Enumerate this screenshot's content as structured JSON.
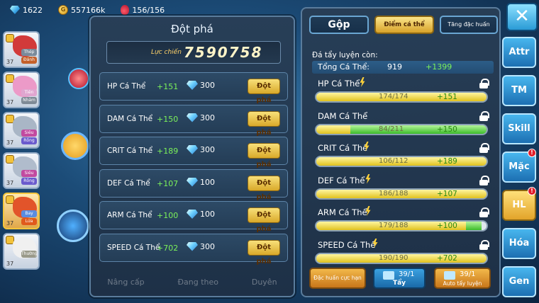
{
  "resources": {
    "gems": "1622",
    "coins": "557166k",
    "stamina": "156/156"
  },
  "team": [
    {
      "lv": "37",
      "type1": "Thép",
      "type2": "Đánh",
      "color": "#d23a3a",
      "tag1": "#7a8a9a",
      "tag2": "#c4602a"
    },
    {
      "lv": "37",
      "type1": "Tiên",
      "type2": "Nhảm",
      "color": "#ec9ac8",
      "tag1": "#e0a6d0",
      "tag2": "#7e8a96"
    },
    {
      "lv": "37",
      "type1": "Siêu",
      "type2": "Rồng",
      "color": "#a9b6c6",
      "tag1": "#c24aa0",
      "tag2": "#6a5acd"
    },
    {
      "lv": "37",
      "type1": "Siêu",
      "type2": "Rồng",
      "color": "#b0bccc",
      "tag1": "#c24aa0",
      "tag2": "#6a5acd"
    },
    {
      "lv": "37",
      "type1": "Bay",
      "type2": "Lửa",
      "color": "#e2542a",
      "tag1": "#5b8ce0",
      "tag2": "#e05a1c"
    },
    {
      "lv": "37",
      "type1": "Thường",
      "type2": "",
      "color": "#f0f0f0",
      "tag1": "#9a9a8a",
      "tag2": ""
    }
  ],
  "breakthrough": {
    "title": "Đột phá",
    "power_label": "Lực chiến",
    "power_value": "7590758",
    "rows": [
      {
        "name": "HP Cá Thể",
        "bonus": "+151",
        "cost": "300",
        "button": "Đột phá"
      },
      {
        "name": "DAM Cá Thể",
        "bonus": "+150",
        "cost": "300",
        "button": "Đột phá"
      },
      {
        "name": "CRIT Cá Thể",
        "bonus": "+189",
        "cost": "300",
        "button": "Đột phá"
      },
      {
        "name": "DEF Cá Thể",
        "bonus": "+107",
        "cost": "100",
        "button": "Đột phá"
      },
      {
        "name": "ARM Cá Thể",
        "bonus": "+100",
        "cost": "100",
        "button": "Đột phá"
      },
      {
        "name": "SPEED Cá Thể",
        "bonus": "+702",
        "cost": "300",
        "button": "Đột phá"
      }
    ],
    "bottom_nav": [
      "Nâng cấp",
      "Đang theo",
      "Duyên"
    ]
  },
  "individual": {
    "tabs": [
      "Gộp",
      "Điểm cá thể",
      "Tăng đặc huấn"
    ],
    "hint": "Đá tẩy luyện còn:",
    "total_label": "Tổng Cá Thể:",
    "total_value": "919",
    "total_bonus": "+1399",
    "stats": [
      {
        "name": "HP Cá Thể",
        "current": "174/174",
        "bonus": "+151",
        "fill": 1.0,
        "bonus_start": 1.0,
        "bonus_end": 1.0
      },
      {
        "name": "DAM Cá Thể",
        "current": "84/211",
        "bonus": "+150",
        "fill": 0.2,
        "bonus_start": 0.2,
        "bonus_end": 1.0
      },
      {
        "name": "CRIT Cá Thể",
        "current": "106/112",
        "bonus": "+189",
        "fill": 1.0,
        "bonus_start": 1.0,
        "bonus_end": 1.0
      },
      {
        "name": "DEF Cá Thể",
        "current": "186/188",
        "bonus": "+107",
        "fill": 1.0,
        "bonus_start": 1.0,
        "bonus_end": 1.0
      },
      {
        "name": "ARM Cá Thể",
        "current": "179/188",
        "bonus": "+100",
        "fill": 0.88,
        "bonus_start": 0.88,
        "bonus_end": 0.97
      },
      {
        "name": "SPEED Cá Thể",
        "current": "190/190",
        "bonus": "+702",
        "fill": 1.0,
        "bonus_start": 1.0,
        "bonus_end": 1.0
      }
    ],
    "buttons": {
      "special": "Đặc huấn cực hạn",
      "wash_count": "39/1",
      "wash_label": "Tẩy",
      "auto_count": "39/1",
      "auto_label": "Auto tẩy luyện"
    }
  },
  "side_menu": [
    {
      "label": "Attr",
      "badge": false,
      "active": false
    },
    {
      "label": "TM",
      "badge": false,
      "active": false
    },
    {
      "label": "Skill",
      "badge": false,
      "active": false
    },
    {
      "label": "Mặc",
      "badge": true,
      "active": false
    },
    {
      "label": "HL",
      "badge": true,
      "active": true
    },
    {
      "label": "Hóa",
      "badge": false,
      "active": false
    },
    {
      "label": "Gen",
      "badge": false,
      "active": false
    }
  ],
  "close_label": "✕"
}
